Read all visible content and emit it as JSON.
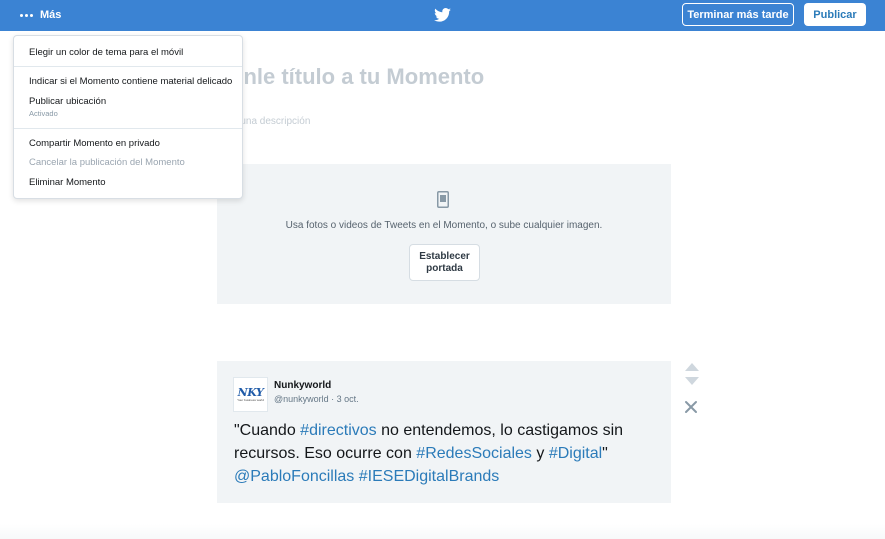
{
  "topbar": {
    "more_label": "Más",
    "later_button": "Terminar más tarde",
    "publish_button": "Publicar",
    "logo_icon": "twitter-bird-icon"
  },
  "menu": {
    "theme_color": "Elegir un color de tema para el móvil",
    "sensitive": "Indicar si el Momento contiene material delicado",
    "location": "Publicar ubicación",
    "location_status": "Activado",
    "share_private": "Compartir Momento en privado",
    "cancel_publish": "Cancelar la publicación del Momento",
    "delete": "Eliminar Momento"
  },
  "editor": {
    "title_placeholder": "onle título a tu Momento",
    "description_placeholder": "e una descripción"
  },
  "cover": {
    "hint": "Usa fotos o videos de Tweets en el Momento, o sube cualquier imagen.",
    "button_line1": "Establecer",
    "button_line2": "portada"
  },
  "tweet": {
    "avatar_logo": "NKY",
    "avatar_tagline": "Your business world",
    "name": "Nunkyworld",
    "handle_date": "@nunkyworld · 3 oct.",
    "p1": "\"Cuando ",
    "h1": "#directivos",
    "p2": " no entendemos, lo castigamos sin recursos. Eso ocurre con ",
    "h2": "#RedesSociales",
    "p3": " y ",
    "h3": "#Digital",
    "p4": "\" ",
    "h4": "@PabloFoncillas",
    "p5": " ",
    "h5": "#IESEDigitalBrands"
  },
  "colors": {
    "topbar": "#3b83d3",
    "link": "#2b7bb9",
    "panel": "#f1f4f6"
  }
}
